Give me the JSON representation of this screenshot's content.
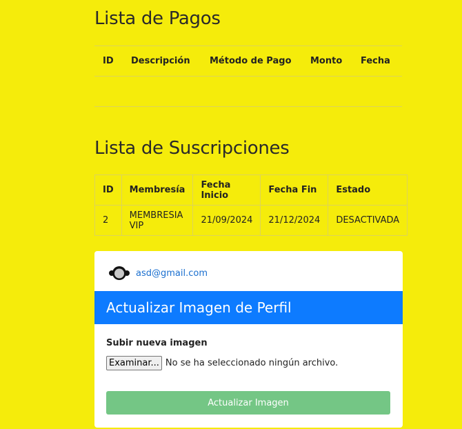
{
  "pagos": {
    "title": "Lista de Pagos",
    "columns": [
      "ID",
      "Descripción",
      "Método de Pago",
      "Monto",
      "Fecha"
    ]
  },
  "suscripciones": {
    "title": "Lista de Suscripciones",
    "columns": [
      "ID",
      "Membresía",
      "Fecha Inicio",
      "Fecha Fin",
      "Estado"
    ],
    "rows": [
      [
        "2",
        "MEMBRESIA VIP",
        "21/09/2024",
        "21/12/2024",
        "DESACTIVADA"
      ]
    ]
  },
  "profile": {
    "email": "asd@gmail.com",
    "avatar_icon": "avatar-icon"
  },
  "update_form": {
    "header": "Actualizar Imagen de Perfil",
    "upload_label": "Subir nueva imagen",
    "browse_button": "Examinar...",
    "file_status": "No se ha seleccionado ningún archivo.",
    "submit_label": "Actualizar Imagen"
  },
  "colors": {
    "background": "#f5ec0b",
    "header_blue": "#0d7bff",
    "submit_green": "#74c685",
    "link_blue": "#1a6fcf"
  }
}
